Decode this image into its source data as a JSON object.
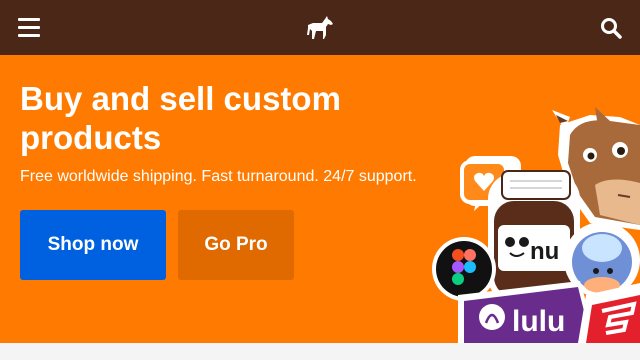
{
  "header": {
    "menu_icon": "hamburger-menu-icon",
    "logo_icon": "horse-logo-icon",
    "search_icon": "search-icon",
    "background": "#4b2718"
  },
  "hero": {
    "title": "Buy and sell custom products",
    "subtitle": "Free worldwide shipping. Fast turnaround. 24/7 support.",
    "primary_button": "Shop now",
    "secondary_button": "Go Pro",
    "background": "#ff7a00",
    "primary_color": "#0061e0",
    "secondary_color": "#e06a00"
  },
  "stickers": {
    "jar_label": "nu",
    "bag_label": "lulu",
    "heart_icon": "heart-speech-bubble-icon",
    "figma_icon": "figma-logo-icon",
    "donkey": "donkey-mascot-sticker",
    "helmet": "helmet-character-sticker",
    "espn": "espn-logo-sticker"
  }
}
